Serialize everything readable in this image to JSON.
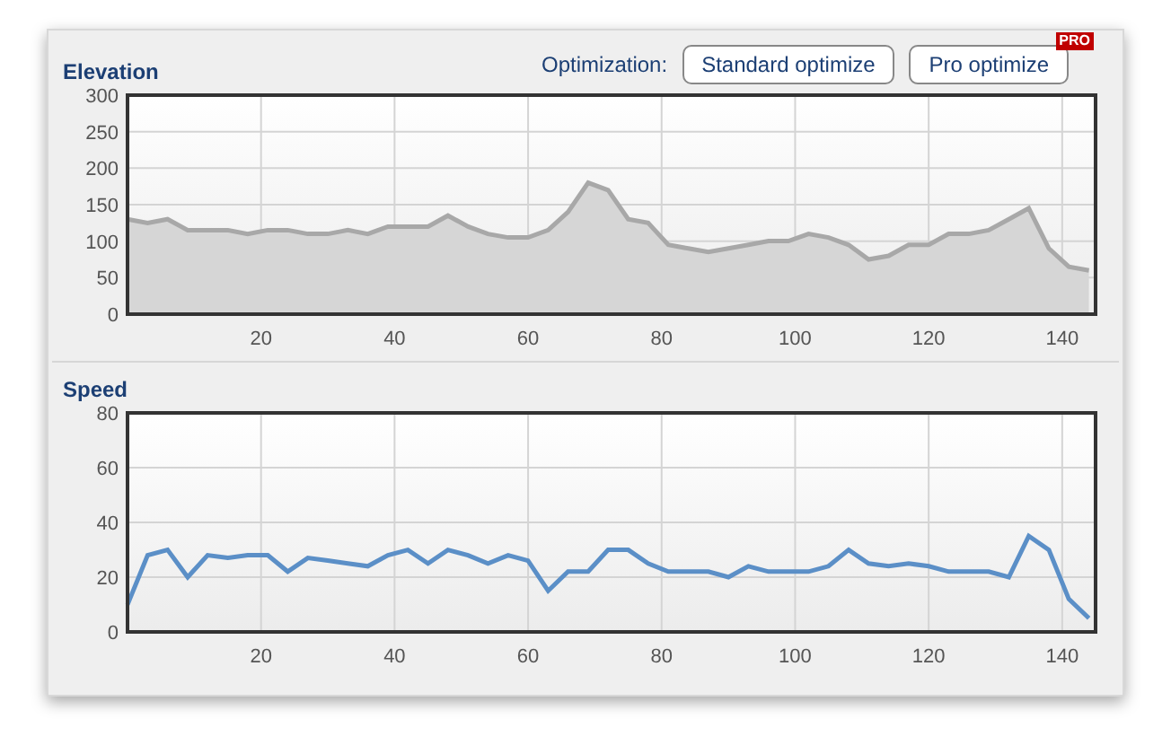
{
  "elevation": {
    "chart_data": {
      "type": "area",
      "title": "Elevation",
      "x": [
        0,
        3,
        6,
        9,
        12,
        15,
        18,
        21,
        24,
        27,
        30,
        33,
        36,
        39,
        42,
        45,
        48,
        51,
        54,
        57,
        60,
        63,
        66,
        69,
        72,
        75,
        78,
        81,
        84,
        87,
        90,
        93,
        96,
        99,
        102,
        105,
        108,
        111,
        114,
        117,
        120,
        123,
        126,
        129,
        132,
        135,
        138,
        141,
        144
      ],
      "grid": true,
      "series": [
        {
          "color": "#a8a8a8",
          "values": [
            130,
            125,
            130,
            115,
            115,
            115,
            110,
            115,
            115,
            110,
            110,
            115,
            110,
            120,
            120,
            120,
            135,
            120,
            110,
            105,
            105,
            115,
            140,
            180,
            170,
            130,
            125,
            95,
            90,
            85,
            90,
            95,
            100,
            100,
            110,
            105,
            95,
            75,
            80,
            95,
            95,
            110,
            110,
            115,
            130,
            145,
            90,
            65,
            60
          ]
        }
      ],
      "xlim": [
        0,
        145
      ],
      "ylim": [
        0,
        300
      ],
      "xticks": [
        20,
        40,
        60,
        80,
        100,
        120,
        140
      ],
      "yticks": [
        0,
        50,
        100,
        150,
        200,
        250,
        300
      ]
    }
  },
  "optimization": {
    "label": "Optimization:",
    "buttons": [
      {
        "label": "Standard optimize"
      },
      {
        "label": "Pro optimize",
        "badge": "PRO"
      }
    ]
  },
  "speed": {
    "chart_data": {
      "type": "line",
      "title": "Speed",
      "x": [
        0,
        3,
        6,
        9,
        12,
        15,
        18,
        21,
        24,
        27,
        30,
        33,
        36,
        39,
        42,
        45,
        48,
        51,
        54,
        57,
        60,
        63,
        66,
        69,
        72,
        75,
        78,
        81,
        84,
        87,
        90,
        93,
        96,
        99,
        102,
        105,
        108,
        111,
        114,
        117,
        120,
        123,
        126,
        129,
        132,
        135,
        138,
        141,
        144
      ],
      "grid": true,
      "series": [
        {
          "color": "#5b8fc7",
          "values": [
            10,
            28,
            30,
            20,
            28,
            27,
            28,
            28,
            22,
            27,
            26,
            25,
            24,
            28,
            30,
            25,
            30,
            28,
            25,
            28,
            26,
            15,
            22,
            22,
            30,
            30,
            25,
            22,
            22,
            22,
            20,
            24,
            22,
            22,
            22,
            24,
            30,
            25,
            24,
            25,
            24,
            22,
            22,
            22,
            20,
            35,
            30,
            12,
            5
          ]
        }
      ],
      "xlim": [
        0,
        145
      ],
      "ylim": [
        0,
        80
      ],
      "xticks": [
        20,
        40,
        60,
        80,
        100,
        120,
        140
      ],
      "yticks": [
        0,
        20,
        40,
        60,
        80
      ]
    }
  }
}
